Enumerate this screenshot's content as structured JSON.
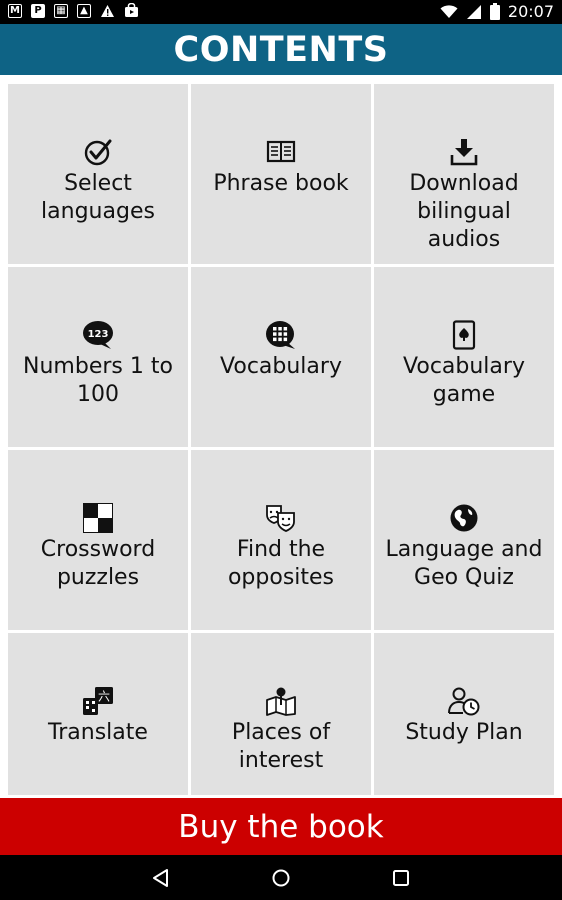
{
  "status_bar": {
    "time": "20:07",
    "left_icons": [
      "gmail-icon",
      "parking-icon",
      "image-icon",
      "photo-icon",
      "warning-icon",
      "shop-icon"
    ]
  },
  "header": {
    "title": "CONTENTS"
  },
  "tiles": [
    {
      "label": "Select languages",
      "icon": "check-circle-icon"
    },
    {
      "label": "Phrase book",
      "icon": "open-book-icon"
    },
    {
      "label": "Download bilingual audios",
      "icon": "download-icon"
    },
    {
      "label": "Numbers 1 to 100",
      "icon": "numbers-bubble-icon"
    },
    {
      "label": "Vocabulary",
      "icon": "grid-bubble-icon"
    },
    {
      "label": "Vocabulary game",
      "icon": "playing-card-icon"
    },
    {
      "label": "Crossword puzzles",
      "icon": "crossword-icon"
    },
    {
      "label": "Find the opposites",
      "icon": "theater-masks-icon"
    },
    {
      "label": "Language and Geo Quiz",
      "icon": "globe-icon"
    },
    {
      "label": "Translate",
      "icon": "translate-icon",
      "badge": "六"
    },
    {
      "label": "Places of interest",
      "icon": "map-pin-icon"
    },
    {
      "label": "Study Plan",
      "icon": "person-clock-icon"
    }
  ],
  "buy_button": {
    "label": "Buy the book"
  },
  "colors": {
    "header": "#0e6385",
    "buy": "#cc0000",
    "tile": "#e1e1e1"
  }
}
